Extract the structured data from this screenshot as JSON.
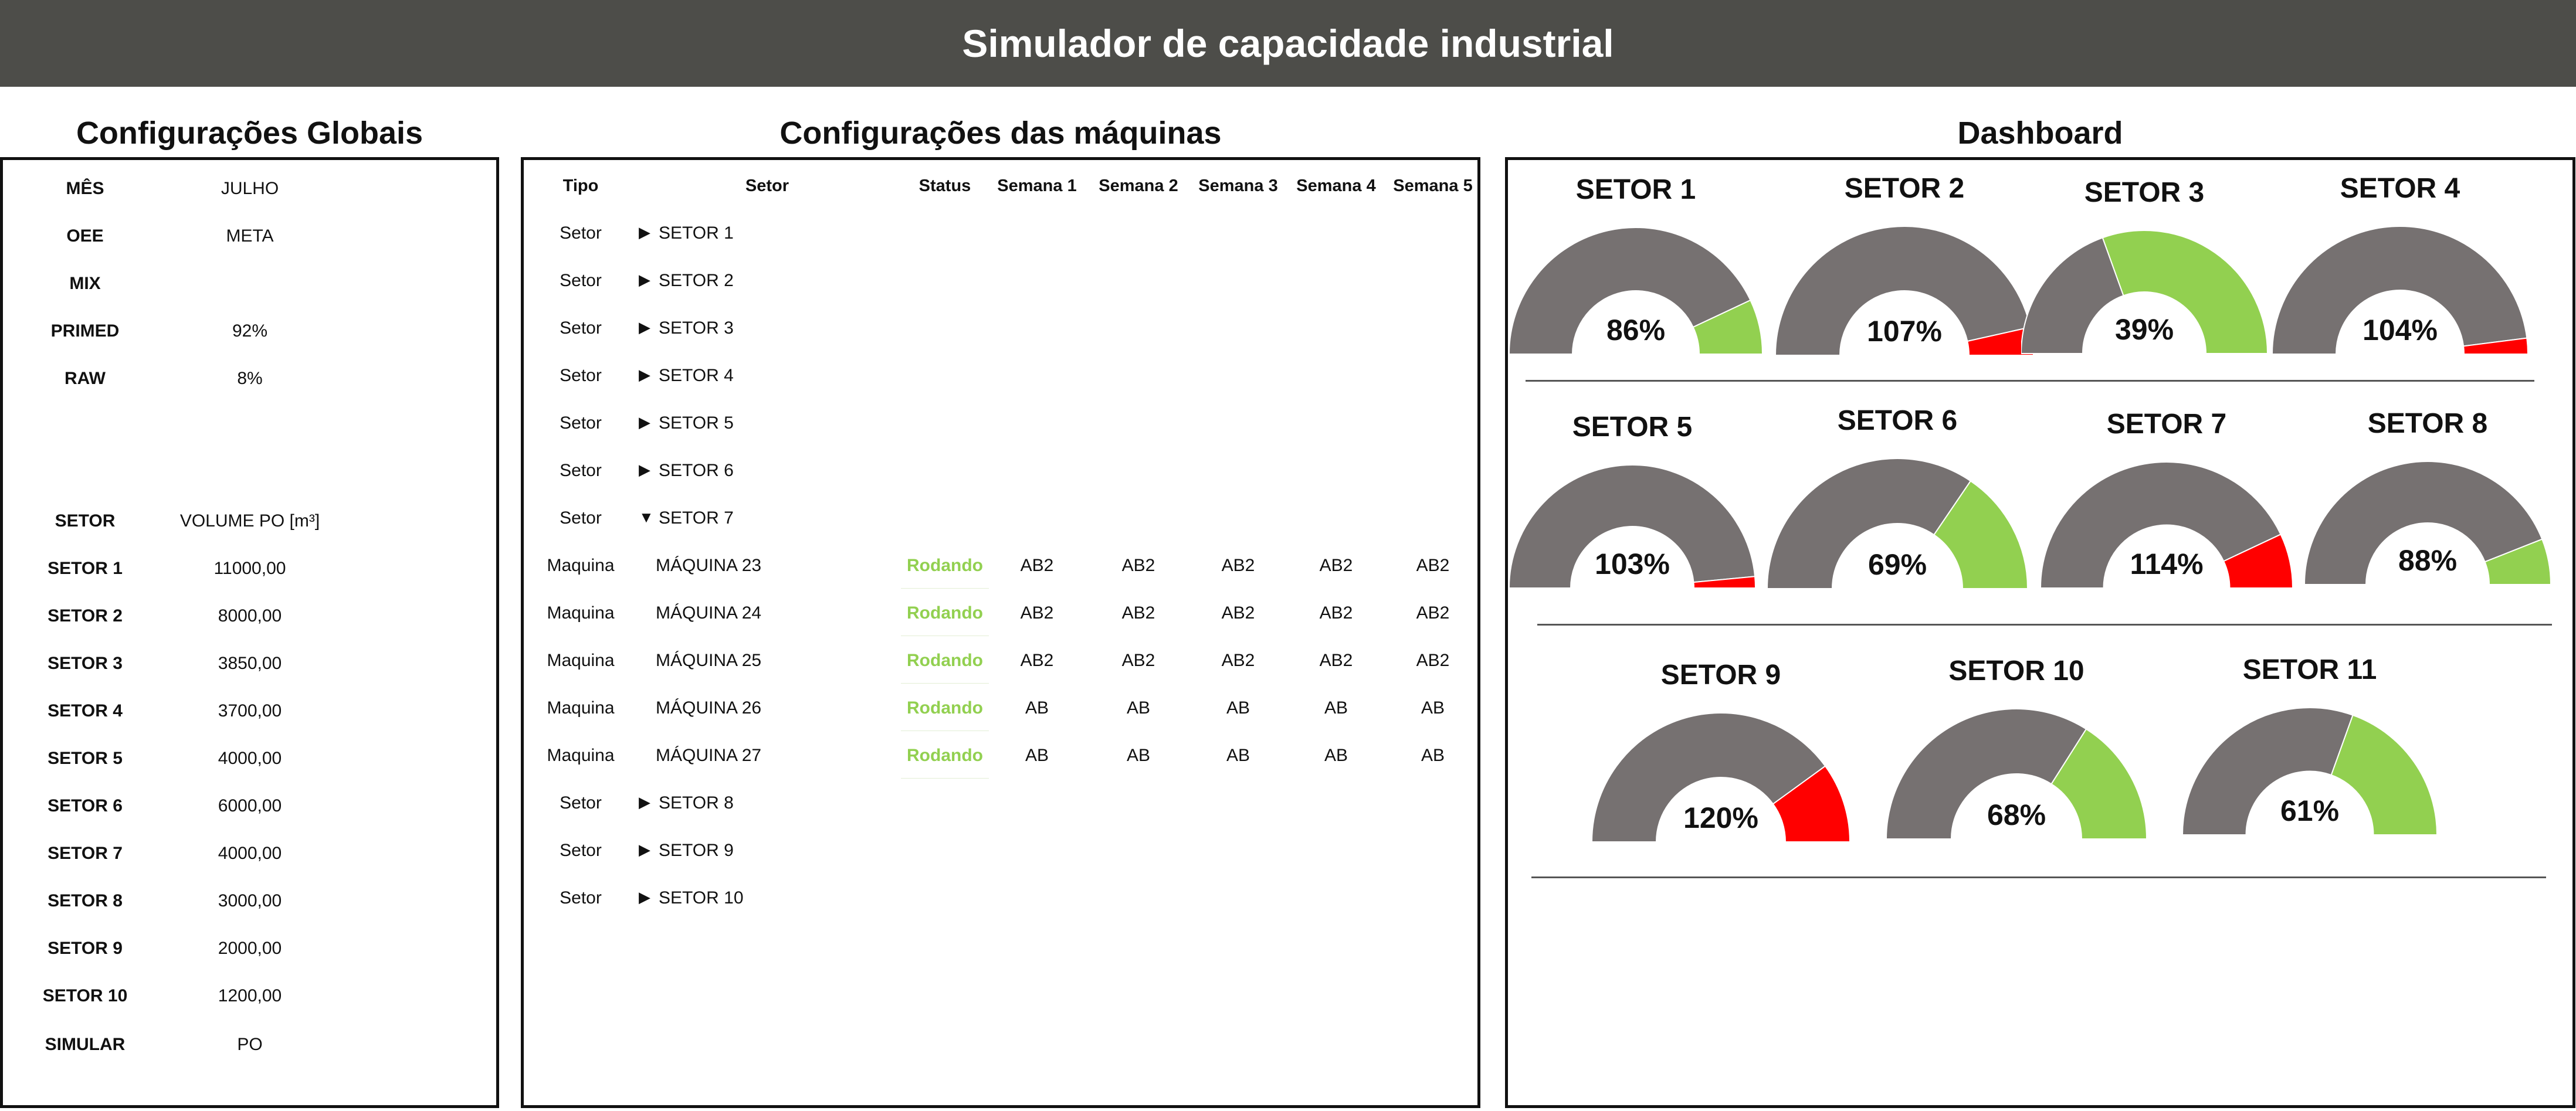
{
  "header": {
    "title": "Simulador de capacidade industrial"
  },
  "sections": {
    "global": "Configurações Globais",
    "machines": "Configurações das máquinas",
    "dashboard": "Dashboard"
  },
  "global": {
    "settings": [
      {
        "label": "MÊS",
        "value": "JULHO"
      },
      {
        "label": "OEE",
        "value": "META"
      },
      {
        "label": "MIX",
        "value": ""
      },
      {
        "label": "PRIMED",
        "value": "92%"
      },
      {
        "label": "RAW",
        "value": "8%"
      }
    ],
    "volume_header": {
      "label": "SETOR",
      "value": "VOLUME PO [m³]"
    },
    "volumes": [
      {
        "label": "SETOR 1",
        "value": "11000,00"
      },
      {
        "label": "SETOR 2",
        "value": "8000,00"
      },
      {
        "label": "SETOR 3",
        "value": "3850,00"
      },
      {
        "label": "SETOR 4",
        "value": "3700,00"
      },
      {
        "label": "SETOR 5",
        "value": "4000,00"
      },
      {
        "label": "SETOR 6",
        "value": "6000,00"
      },
      {
        "label": "SETOR 7",
        "value": "4000,00"
      },
      {
        "label": "SETOR 8",
        "value": "3000,00"
      },
      {
        "label": "SETOR 9",
        "value": "2000,00"
      },
      {
        "label": "SETOR 10",
        "value": "1200,00"
      }
    ],
    "simulate": {
      "label": "SIMULAR",
      "value": "PO"
    }
  },
  "machines": {
    "headers": [
      "Tipo",
      "Setor",
      "Status",
      "Semana 1",
      "Semana 2",
      "Semana 3",
      "Semana 4",
      "Semana 5"
    ],
    "rows": [
      {
        "tipo": "Setor",
        "arrow": "▶",
        "setor": "SETOR 1",
        "status": "",
        "weeks": [
          "",
          "",
          "",
          "",
          ""
        ]
      },
      {
        "tipo": "Setor",
        "arrow": "▶",
        "setor": "SETOR 2",
        "status": "",
        "weeks": [
          "",
          "",
          "",
          "",
          ""
        ]
      },
      {
        "tipo": "Setor",
        "arrow": "▶",
        "setor": "SETOR 3",
        "status": "",
        "weeks": [
          "",
          "",
          "",
          "",
          ""
        ]
      },
      {
        "tipo": "Setor",
        "arrow": "▶",
        "setor": "SETOR 4",
        "status": "",
        "weeks": [
          "",
          "",
          "",
          "",
          ""
        ]
      },
      {
        "tipo": "Setor",
        "arrow": "▶",
        "setor": "SETOR 5",
        "status": "",
        "weeks": [
          "",
          "",
          "",
          "",
          ""
        ]
      },
      {
        "tipo": "Setor",
        "arrow": "▶",
        "setor": "SETOR 6",
        "status": "",
        "weeks": [
          "",
          "",
          "",
          "",
          ""
        ]
      },
      {
        "tipo": "Setor",
        "arrow": "▼",
        "setor": "SETOR 7",
        "status": "",
        "weeks": [
          "",
          "",
          "",
          "",
          ""
        ]
      },
      {
        "tipo": "Maquina",
        "arrow": "",
        "setor": "MÁQUINA 23",
        "status": "Rodando",
        "weeks": [
          "AB2",
          "AB2",
          "AB2",
          "AB2",
          "AB2"
        ]
      },
      {
        "tipo": "Maquina",
        "arrow": "",
        "setor": "MÁQUINA 24",
        "status": "Rodando",
        "weeks": [
          "AB2",
          "AB2",
          "AB2",
          "AB2",
          "AB2"
        ]
      },
      {
        "tipo": "Maquina",
        "arrow": "",
        "setor": "MÁQUINA 25",
        "status": "Rodando",
        "weeks": [
          "AB2",
          "AB2",
          "AB2",
          "AB2",
          "AB2"
        ]
      },
      {
        "tipo": "Maquina",
        "arrow": "",
        "setor": "MÁQUINA 26",
        "status": "Rodando",
        "weeks": [
          "AB",
          "AB",
          "AB",
          "AB",
          "AB"
        ]
      },
      {
        "tipo": "Maquina",
        "arrow": "",
        "setor": "MÁQUINA 27",
        "status": "Rodando",
        "weeks": [
          "AB",
          "AB",
          "AB",
          "AB",
          "AB"
        ]
      },
      {
        "tipo": "Setor",
        "arrow": "▶",
        "setor": "SETOR 8",
        "status": "",
        "weeks": [
          "",
          "",
          "",
          "",
          ""
        ]
      },
      {
        "tipo": "Setor",
        "arrow": "▶",
        "setor": "SETOR 9",
        "status": "",
        "weeks": [
          "",
          "",
          "",
          "",
          ""
        ]
      },
      {
        "tipo": "Setor",
        "arrow": "▶",
        "setor": "SETOR 10",
        "status": "",
        "weeks": [
          "",
          "",
          "",
          "",
          ""
        ]
      }
    ]
  },
  "dashboard": {
    "colors": {
      "base": "#767171",
      "ok": "#92d050",
      "over": "#ff0000",
      "status_ok": "#92d050"
    },
    "gauges": [
      {
        "name": "SETOR 1",
        "label": "86%",
        "value": 86
      },
      {
        "name": "SETOR 2",
        "label": "107%",
        "value": 107
      },
      {
        "name": "SETOR 3",
        "label": "39%",
        "value": 39
      },
      {
        "name": "SETOR 4",
        "label": "104%",
        "value": 104
      },
      {
        "name": "SETOR 5",
        "label": "103%",
        "value": 103
      },
      {
        "name": "SETOR 6",
        "label": "69%",
        "value": 69
      },
      {
        "name": "SETOR 7",
        "label": "114%",
        "value": 114
      },
      {
        "name": "SETOR 8",
        "label": "88%",
        "value": 88
      },
      {
        "name": "SETOR 9",
        "label": "120%",
        "value": 120
      },
      {
        "name": "SETOR 10",
        "label": "68%",
        "value": 68
      },
      {
        "name": "SETOR 11",
        "label": "61%",
        "value": 61
      }
    ]
  }
}
